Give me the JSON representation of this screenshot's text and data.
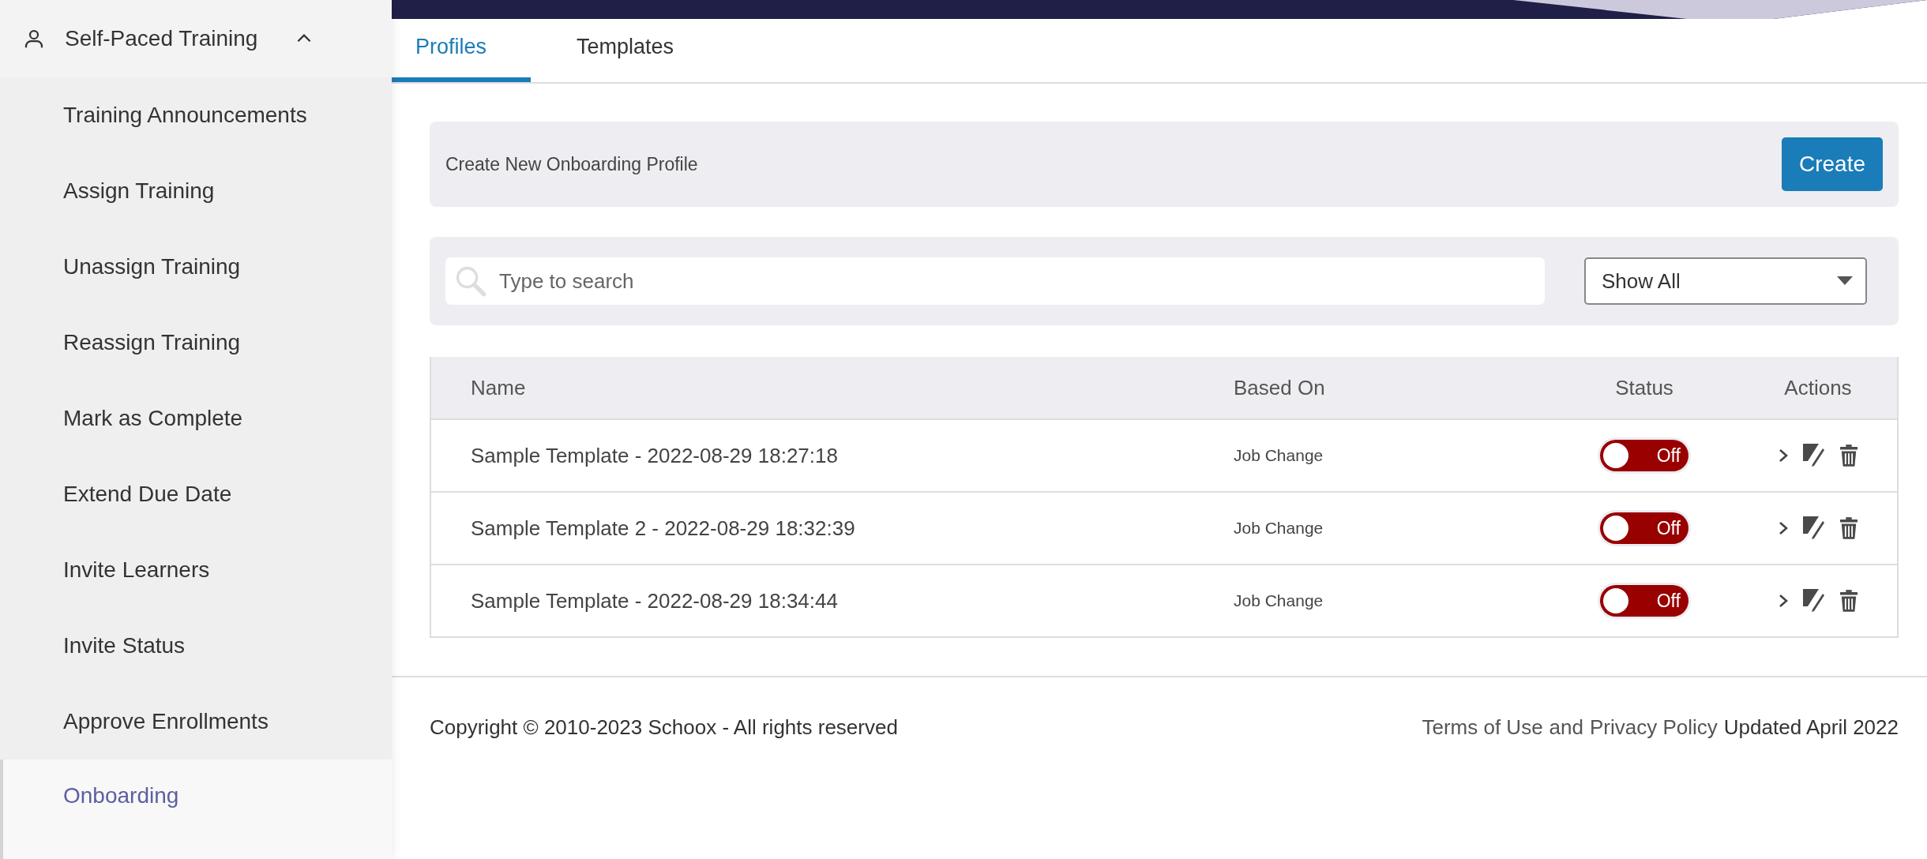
{
  "sidebar": {
    "section": {
      "label": "Self-Paced Training",
      "expanded": true
    },
    "items": [
      {
        "label": "Training Announcements",
        "selected": false
      },
      {
        "label": "Assign Training",
        "selected": false
      },
      {
        "label": "Unassign Training",
        "selected": false
      },
      {
        "label": "Reassign Training",
        "selected": false
      },
      {
        "label": "Mark as Complete",
        "selected": false
      },
      {
        "label": "Extend Due Date",
        "selected": false
      },
      {
        "label": "Invite Learners",
        "selected": false
      },
      {
        "label": "Invite Status",
        "selected": false
      },
      {
        "label": "Approve Enrollments",
        "selected": false
      },
      {
        "label": "Onboarding",
        "selected": true
      }
    ]
  },
  "tabs": [
    {
      "label": "Profiles",
      "selected": true
    },
    {
      "label": "Templates",
      "selected": false
    }
  ],
  "create_panel": {
    "label": "Create New Onboarding Profile",
    "button": "Create"
  },
  "search": {
    "placeholder": "Type to search"
  },
  "filter": {
    "value": "Show All"
  },
  "table": {
    "columns": [
      "Name",
      "Based On",
      "Status",
      "Actions"
    ],
    "rows": [
      {
        "name": "Sample Template - 2022-08-29 18:27:18",
        "based_on": "Job Change",
        "status": {
          "on": false,
          "label": "Off"
        }
      },
      {
        "name": "Sample Template 2 - 2022-08-29 18:32:39",
        "based_on": "Job Change",
        "status": {
          "on": false,
          "label": "Off"
        }
      },
      {
        "name": "Sample Template - 2022-08-29 18:34:44",
        "based_on": "Job Change",
        "status": {
          "on": false,
          "label": "Off"
        }
      }
    ]
  },
  "footer": {
    "copyright": "Copyright © 2010-2023 Schoox - All rights reserved",
    "terms": "Terms of Use",
    "and": "and",
    "privacy": "Privacy Policy",
    "updated": "Updated April 2022"
  }
}
